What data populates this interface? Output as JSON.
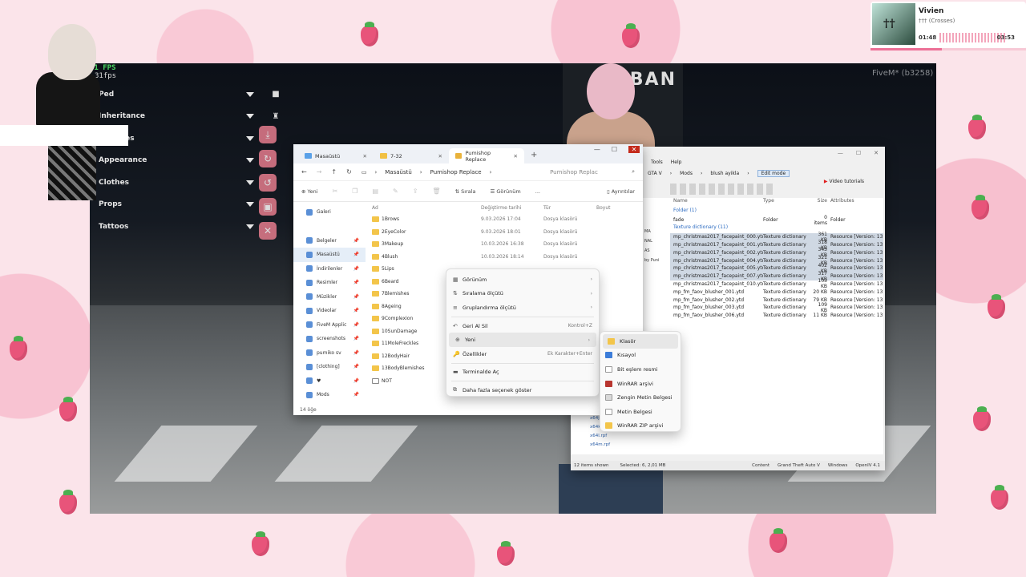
{
  "overlay": {
    "fps_main": "31 FPS",
    "fps_small": "31fps",
    "platform": "FiveM* (b3258)"
  },
  "music": {
    "cover_text": "††",
    "title": "Vivien",
    "artist": "††† (Crosses)",
    "elapsed": "01:48",
    "total": "03:53",
    "progress": 0.46
  },
  "game_menu": {
    "items": [
      "Ped",
      "Inheritance",
      "Features",
      "Appearance",
      "Clothes",
      "Props",
      "Tattoos"
    ]
  },
  "game": {
    "sign_text": "BAN"
  },
  "explorer": {
    "tabs": [
      "Masaüstü",
      "7-32",
      "Pumishop Replace"
    ],
    "breadcrumb": [
      "Masaüstü",
      "Pumishop Replace"
    ],
    "search_placeholder": "Pumishop Replac",
    "commands": {
      "new": "Yeni",
      "sort": "Sırala",
      "view": "Görünüm",
      "more": "...",
      "details": "Ayrıntılar"
    },
    "nav": [
      {
        "label": "Galeri",
        "pinned": false
      },
      {
        "label": "Belgeler",
        "pinned": true
      },
      {
        "label": "Masaüstü",
        "pinned": true
      },
      {
        "label": "İndirilenler",
        "pinned": true
      },
      {
        "label": "Resimler",
        "pinned": true
      },
      {
        "label": "Müzikler",
        "pinned": true
      },
      {
        "label": "Videolar",
        "pinned": true
      },
      {
        "label": "FiveM Applic",
        "pinned": true
      },
      {
        "label": "screenshots",
        "pinned": true
      },
      {
        "label": "pumiko sv",
        "pinned": true
      },
      {
        "label": "[clothing]",
        "pinned": true
      },
      {
        "label": "♥",
        "pinned": true
      },
      {
        "label": "Mods",
        "pinned": true
      }
    ],
    "columns": [
      "Ad",
      "Değiştirme tarihi",
      "Tür",
      "Boyut"
    ],
    "rows": [
      {
        "name": "1Brows",
        "date": "9.03.2026 17:04",
        "type": "Dosya klasörü",
        "doc": false
      },
      {
        "name": "2EyeColor",
        "date": "9.03.2026 18:01",
        "type": "Dosya klasörü",
        "doc": false
      },
      {
        "name": "3Makeup",
        "date": "10.03.2026 16:38",
        "type": "Dosya klasörü",
        "doc": false
      },
      {
        "name": "4Blush",
        "date": "10.03.2026 18:14",
        "type": "Dosya klasörü",
        "doc": false
      },
      {
        "name": "5Lips",
        "date": "",
        "type": "",
        "doc": false
      },
      {
        "name": "6Beard",
        "date": "",
        "type": "",
        "doc": false
      },
      {
        "name": "7Blemishes",
        "date": "",
        "type": "",
        "doc": false
      },
      {
        "name": "8Ageing",
        "date": "",
        "type": "",
        "doc": false
      },
      {
        "name": "9Complexion",
        "date": "",
        "type": "",
        "doc": false
      },
      {
        "name": "10SunDamage",
        "date": "",
        "type": "",
        "doc": false
      },
      {
        "name": "11MoleFreckles",
        "date": "",
        "type": "",
        "doc": false
      },
      {
        "name": "12BodyHair",
        "date": "",
        "type": "",
        "doc": false
      },
      {
        "name": "13BodyBlemishes",
        "date": "",
        "type": "",
        "doc": false
      },
      {
        "name": "NOT",
        "date": "",
        "type": "",
        "doc": true
      }
    ],
    "status": "14 öğe"
  },
  "context_menu": {
    "items": [
      {
        "label": "Görünüm",
        "icon": "grid-icon",
        "shortcut": "",
        "arrow": true
      },
      {
        "label": "Sıralama ölçütü",
        "icon": "sort-icon",
        "shortcut": "",
        "arrow": true
      },
      {
        "label": "Gruplandırma ölçütü",
        "icon": "group-icon",
        "shortcut": "",
        "arrow": true
      },
      {
        "label": "Geri Al Sil",
        "icon": "undo-icon",
        "shortcut": "Kontrol+Z",
        "arrow": false
      },
      {
        "label": "Yeni",
        "icon": "new-icon",
        "shortcut": "",
        "arrow": true
      },
      {
        "label": "Özellikler",
        "icon": "properties-icon",
        "shortcut": "Ek Karakter+Enter",
        "arrow": false
      },
      {
        "label": "Terminalde Aç",
        "icon": "terminal-icon",
        "shortcut": "",
        "arrow": false
      },
      {
        "label": "Daha fazla seçenek göster",
        "icon": "more-options-icon",
        "shortcut": "",
        "arrow": false
      }
    ]
  },
  "submenu": {
    "items": [
      "Klasör",
      "Kısayol",
      "Bit eşlem resmi",
      "WinRAR arşivi",
      "Zengin Metin Belgesi",
      "Metin Belgesi",
      "WinRAR ZIP arşivi"
    ]
  },
  "openiv": {
    "menu": [
      "Tools",
      "Help"
    ],
    "path": [
      "GTA V",
      "Mods",
      "blush ayikla"
    ],
    "edit_mode": "Edit mode",
    "video_tutorials": "Video tutorials",
    "columns": [
      "Name",
      "Type",
      "Size",
      "Attributes"
    ],
    "folder_group": "Folder (1)",
    "folder_row": {
      "name": "fade",
      "type": "Folder",
      "size": "0 items",
      "attr": "Folder"
    },
    "texture_group": "Texture dictionary (11)",
    "rows": [
      {
        "name": "mp_christmas2017_facepaint_000.ytd",
        "type": "Texture dictionary",
        "size": "361 KB",
        "attr": "Resource [Version: 13]",
        "sel": true
      },
      {
        "name": "mp_christmas2017_facepaint_001.ytd",
        "type": "Texture dictionary",
        "size": "318 KB",
        "attr": "Resource [Version: 13]",
        "sel": true
      },
      {
        "name": "mp_christmas2017_facepaint_002.ytd",
        "type": "Texture dictionary",
        "size": "343 KB",
        "attr": "Resource [Version: 13]",
        "sel": true
      },
      {
        "name": "mp_christmas2017_facepaint_004.ytd",
        "type": "Texture dictionary",
        "size": "321 KB",
        "attr": "Resource [Version: 13]",
        "sel": true
      },
      {
        "name": "mp_christmas2017_facepaint_005.ytd",
        "type": "Texture dictionary",
        "size": "402 KB",
        "attr": "Resource [Version: 13]",
        "sel": true
      },
      {
        "name": "mp_christmas2017_facepaint_007.ytd",
        "type": "Texture dictionary",
        "size": "317 KB",
        "attr": "Resource [Version: 13]",
        "sel": true
      },
      {
        "name": "mp_christmas2017_facepaint_010.ytd",
        "type": "Texture dictionary",
        "size": "103 KB",
        "attr": "Resource [Version: 13]",
        "sel": false
      },
      {
        "name": "mp_fm_faov_blusher_001.ytd",
        "type": "Texture dictionary",
        "size": "20 KB",
        "attr": "Resource [Version: 13]",
        "sel": false
      },
      {
        "name": "mp_fm_faov_blusher_002.ytd",
        "type": "Texture dictionary",
        "size": "79 KB",
        "attr": "Resource [Version: 13]",
        "sel": false
      },
      {
        "name": "mp_fm_faov_blusher_003.ytd",
        "type": "Texture dictionary",
        "size": "109 KB",
        "attr": "Resource [Version: 13]",
        "sel": false
      },
      {
        "name": "mp_fm_faov_blusher_006.ytd",
        "type": "Texture dictionary",
        "size": "11 KB",
        "attr": "Resource [Version: 13]",
        "sel": false
      }
    ],
    "side_labels": [
      "MA",
      "NAL",
      "AS",
      "by Puni"
    ],
    "left_files": [
      "x64j.rpf",
      "x64k.rpf",
      "x64l.rpf",
      "x64m.rpf"
    ],
    "status": {
      "left": "12 items shown",
      "selected": "Selected: 6, 2,01 MB",
      "r1": "Content",
      "r2": "Grand Theft Auto V",
      "r3": "Windows",
      "r4": "OpenIV 4.1"
    }
  }
}
